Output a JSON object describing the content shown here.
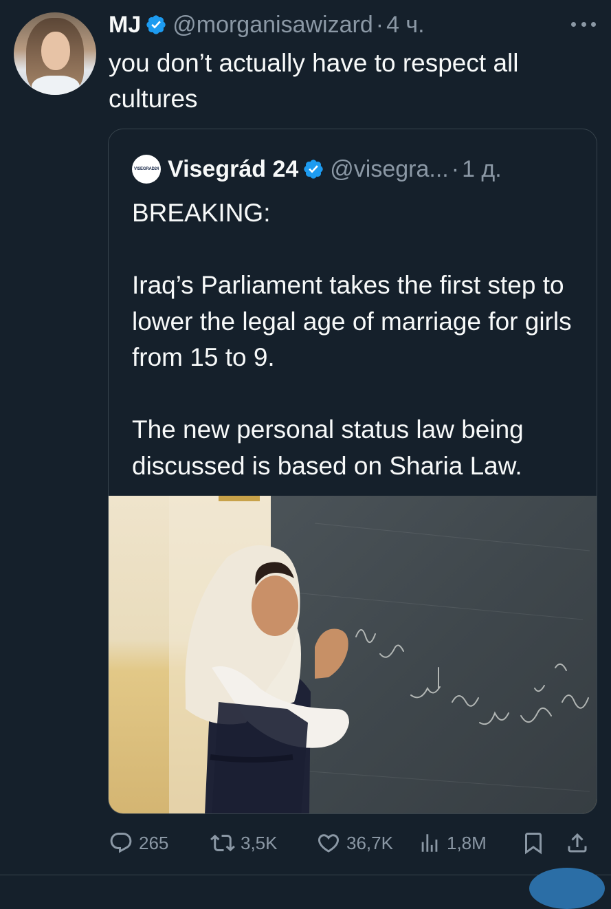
{
  "tweet": {
    "author_name": "MJ",
    "handle": "@morganisawizard",
    "separator": "·",
    "time": "4 ч.",
    "text": "you don’t actually have to respect all cultures"
  },
  "quoted": {
    "logo_text": "VISEGRAD24",
    "author_name": "Visegrád 24",
    "handle": "@visegra...",
    "separator": "·",
    "time": "1 д.",
    "paragraph_1": "BREAKING:",
    "paragraph_2": "Iraq’s Parliament takes the first step to lower the legal age of marriage for girls from 15 to 9.",
    "paragraph_3": "The new personal status law being discussed is based on Sharia Law."
  },
  "actions": {
    "replies": "265",
    "reposts": "3,5K",
    "likes": "36,7K",
    "views": "1,8M"
  },
  "colors": {
    "background": "#15202b",
    "secondary_text": "#8b98a5",
    "verified": "#1d9bf0",
    "border": "#38444d"
  },
  "icons": [
    "more-icon",
    "verified-icon",
    "reply-icon",
    "repost-icon",
    "like-icon",
    "views-icon",
    "bookmark-icon",
    "share-icon"
  ]
}
